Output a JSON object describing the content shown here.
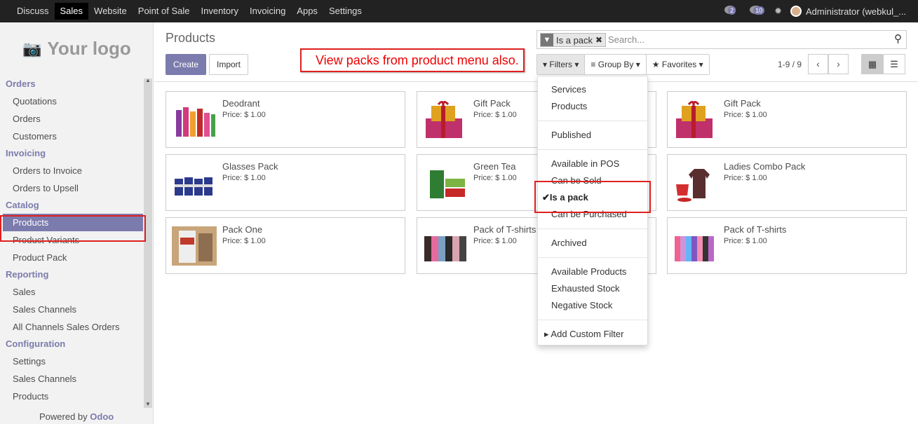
{
  "topbar": {
    "menu": [
      "Discuss",
      "Sales",
      "Website",
      "Point of Sale",
      "Inventory",
      "Invoicing",
      "Apps",
      "Settings"
    ],
    "active": "Sales",
    "chat_count": "2",
    "msg_count": "10",
    "user": "Administrator (webkul_..."
  },
  "sidebar": {
    "logo": "Your logo",
    "sections": [
      {
        "title": "Orders",
        "items": [
          "Quotations",
          "Orders",
          "Customers"
        ]
      },
      {
        "title": "Invoicing",
        "items": [
          "Orders to Invoice",
          "Orders to Upsell"
        ]
      },
      {
        "title": "Catalog",
        "items": [
          "Products",
          "Product Variants",
          "Product Pack"
        ]
      },
      {
        "title": "Reporting",
        "items": [
          "Sales",
          "Sales Channels",
          "All Channels Sales Orders"
        ]
      },
      {
        "title": "Configuration",
        "items": [
          "Settings",
          "Sales Channels",
          "Products"
        ]
      }
    ],
    "active_item": "Products",
    "powered_prefix": "Powered by",
    "powered_brand": "Odoo"
  },
  "main": {
    "title": "Products",
    "create_label": "Create",
    "import_label": "Import",
    "annotation": "View packs from product menu also.",
    "search": {
      "facet": "Is a pack",
      "placeholder": "Search..."
    },
    "filters_label": "Filters",
    "groupby_label": "Group By",
    "favorites_label": "Favorites",
    "pager": "1-9 / 9"
  },
  "products": [
    {
      "name": "Deodrant",
      "price": "Price: $ 1.00",
      "icon": "deodorant-image"
    },
    {
      "name": "Gift Pack",
      "price": "Price: $ 1.00",
      "icon": "gift-image"
    },
    {
      "name": "Gift Pack",
      "price": "Price: $ 1.00",
      "icon": "gift-image"
    },
    {
      "name": "Glasses Pack",
      "price": "Price: $ 1.00",
      "icon": "glasses-image"
    },
    {
      "name": "Green Tea",
      "price": "Price: $ 1.00",
      "icon": "tea-image"
    },
    {
      "name": "Ladies Combo Pack",
      "price": "Price: $ 1.00",
      "icon": "ladies-combo-image"
    },
    {
      "name": "Pack One",
      "price": "Price: $ 1.00",
      "icon": "pack-one-image"
    },
    {
      "name": "Pack of T-shirts",
      "price": "Price: $ 1.00",
      "icon": "tshirts-image"
    },
    {
      "name": "Pack of T-shirts",
      "price": "Price: $ 1.00",
      "icon": "tshirts-image"
    }
  ],
  "filters_menu": {
    "items": [
      "Services",
      "Products",
      "Published",
      "Available in POS",
      "Can be Sold",
      "Is a pack",
      "Can be Purchased",
      "Archived",
      "Available Products",
      "Exhausted Stock",
      "Negative Stock",
      "Add Custom Filter"
    ],
    "selected": "Is a pack"
  },
  "colors": {
    "brand": "#7c7bad",
    "annotation": "#e02020"
  }
}
